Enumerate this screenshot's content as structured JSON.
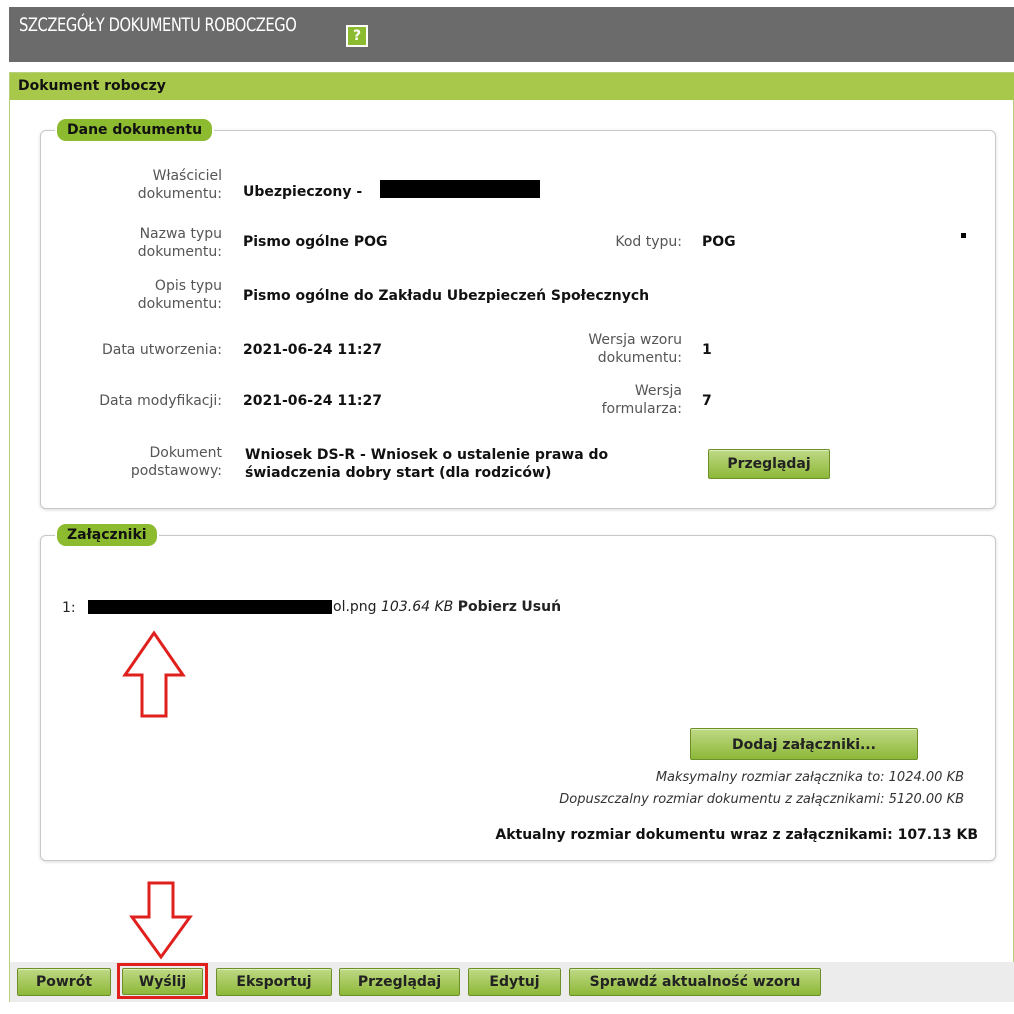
{
  "header": {
    "title": "SZCZEGÓŁY DOKUMENTU ROBOCZEGO",
    "help": "?"
  },
  "panel": {
    "title": "Dokument roboczy"
  },
  "dane": {
    "legend": "Dane dokumentu",
    "owner_label_1": "Właściciel",
    "owner_label_2": "dokumentu:",
    "owner_value": "Ubezpieczony -",
    "type_name_label_1": "Nazwa typu",
    "type_name_label_2": "dokumentu:",
    "type_name_value": "Pismo ogólne POG",
    "type_code_label": "Kod typu:",
    "type_code_value": "POG",
    "type_desc_label_1": "Opis typu",
    "type_desc_label_2": "dokumentu:",
    "type_desc_value": "Pismo ogólne do Zakładu Ubezpieczeń Społecznych",
    "created_label": "Data utworzenia:",
    "created_value": "2021-06-24 11:27",
    "template_version_label_1": "Wersja wzoru",
    "template_version_label_2": "dokumentu:",
    "template_version_value": "1",
    "modified_label": "Data modyfikacji:",
    "modified_value": "2021-06-24 11:27",
    "form_version_label_1": "Wersja",
    "form_version_label_2": "formularza:",
    "form_version_value": "7",
    "base_doc_label_1": "Dokument",
    "base_doc_label_2": "podstawowy:",
    "base_doc_value_1": "Wniosek DS-R - Wniosek o ustalenie prawa do",
    "base_doc_value_2": "świadczenia dobry start (dla rodziców)",
    "browse_button": "Przeglądaj"
  },
  "attachments": {
    "legend": "Załączniki",
    "items": [
      {
        "index": "1:",
        "name_suffix": "ol.png",
        "size": "103.64 KB",
        "download": "Pobierz",
        "delete": "Usuń"
      }
    ],
    "add_button": "Dodaj załączniki...",
    "max_attachment_note": "Maksymalny rozmiar załącznika to: 1024.00 KB",
    "max_doc_note": "Dopuszczalny rozmiar dokumentu z załącznikami: 5120.00 KB",
    "current_size": "Aktualny rozmiar dokumentu wraz z załącznikami: 107.13 KB"
  },
  "toolbar": {
    "back": "Powrót",
    "send": "Wyślij",
    "export": "Eksportuj",
    "browse": "Przeglądaj",
    "edit": "Edytuj",
    "check_template": "Sprawdź aktualność wzoru"
  },
  "colors": {
    "header_bg": "#6b6b6b",
    "accent_green": "#8dbb2f",
    "panel_header": "#a7c84a",
    "annotation_red": "#e0201c"
  }
}
